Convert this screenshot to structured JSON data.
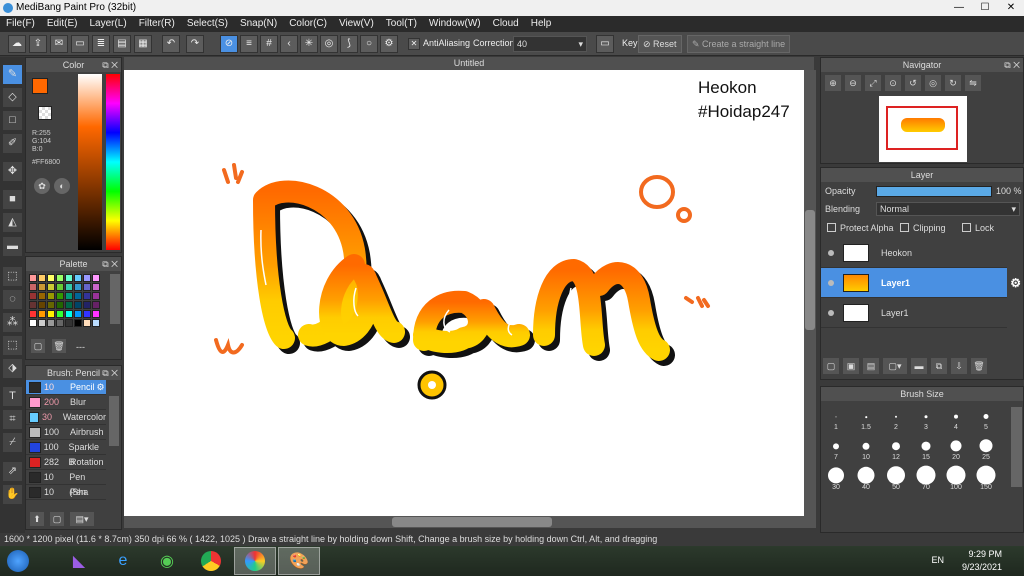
{
  "app": {
    "title": "MediBang Paint Pro (32bit)"
  },
  "menu": [
    "File(F)",
    "Edit(E)",
    "Layer(L)",
    "Filter(R)",
    "Select(S)",
    "Snap(N)",
    "Color(C)",
    "View(V)",
    "Tool(T)",
    "Window(W)",
    "Cloud",
    "Help"
  ],
  "toolbar": {
    "antialiasing_label": "AntiAliasing",
    "correction_label": "Correction",
    "correction_value": "40",
    "key_label": "Key",
    "reset_label": "Reset",
    "straight_line_label": "Create a straight line"
  },
  "document": {
    "title": "Untitled",
    "watermark_line1": "Heokon",
    "watermark_line2": "#Hoidap247"
  },
  "color_panel": {
    "title": "Color",
    "r": "R:255",
    "g": "G:104",
    "b": "B:0",
    "hex": "#FF6800",
    "main_color": "#FF6800"
  },
  "palette_panel": {
    "title": "Palette",
    "footer": "---",
    "colors": [
      "#ff9999",
      "#ffcc66",
      "#ffff66",
      "#99ff66",
      "#66ffcc",
      "#66ccff",
      "#9999ff",
      "#ff99ff",
      "#cc6666",
      "#cc9933",
      "#cccc33",
      "#66cc33",
      "#33ccaa",
      "#3399cc",
      "#6666cc",
      "#cc66cc",
      "#993333",
      "#996600",
      "#999900",
      "#339900",
      "#009977",
      "#006699",
      "#333399",
      "#993399",
      "#663333",
      "#664400",
      "#666600",
      "#226600",
      "#006644",
      "#004466",
      "#222266",
      "#662266",
      "#ff3333",
      "#ff9900",
      "#ffee00",
      "#33ff33",
      "#00ffee",
      "#0099ff",
      "#3333ff",
      "#ff33ff",
      "#ffffff",
      "#cccccc",
      "#999999",
      "#666666",
      "#333333",
      "#000000",
      "#ffddbb",
      "#bbddff"
    ]
  },
  "brush_panel": {
    "title": "Brush: Pencil",
    "items": [
      {
        "size": "10",
        "name": "Pencil",
        "color": "#2a2a2a"
      },
      {
        "size": "200",
        "name": "Blur",
        "color": "#ff99cc"
      },
      {
        "size": "30",
        "name": "Watercolor",
        "color": "#66ccff"
      },
      {
        "size": "100",
        "name": "Airbrush",
        "color": "#bbbbbb"
      },
      {
        "size": "100",
        "name": "Sparkle B",
        "color": "#2244dd"
      },
      {
        "size": "282",
        "name": "Rotation",
        "color": "#dd2222"
      },
      {
        "size": "10",
        "name": "Pen (Sha",
        "color": "#2a2a2a"
      },
      {
        "size": "10",
        "name": "Pen",
        "color": "#2a2a2a"
      }
    ]
  },
  "navigator": {
    "title": "Navigator"
  },
  "layer_panel": {
    "title": "Layer",
    "opacity_label": "Opacity",
    "opacity_value": "100 %",
    "opacity_fraction": 1.0,
    "blending_label": "Blending",
    "blending_value": "Normal",
    "protect_alpha": "Protect Alpha",
    "clipping": "Clipping",
    "lock": "Lock",
    "layers": [
      "Heokon",
      "Layer1",
      "Layer1"
    ]
  },
  "brush_size_panel": {
    "title": "Brush Size",
    "sizes": [
      "1",
      "1.5",
      "2",
      "3",
      "4",
      "5",
      "7",
      "10",
      "12",
      "15",
      "20",
      "25",
      "30",
      "40",
      "50",
      "70",
      "100",
      "150"
    ]
  },
  "status": {
    "text": "1600 * 1200 pixel   (11.6 * 8.7cm)   350 dpi   66 %   ( 1422, 1025 )   Draw a straight line by holding down Shift, Change a brush size by holding down Ctrl, Alt, and dragging"
  },
  "taskbar": {
    "lang": "EN",
    "time": "9:29 PM",
    "date": "9/23/2021"
  }
}
